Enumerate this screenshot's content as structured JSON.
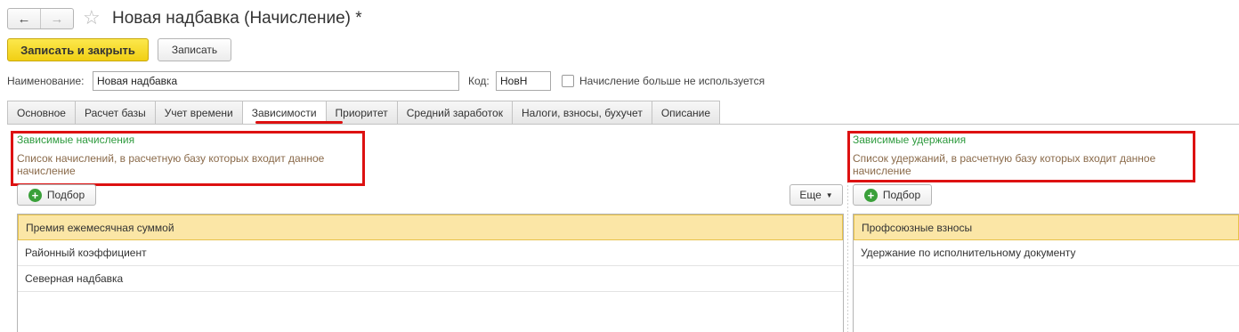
{
  "window": {
    "title": "Новая надбавка (Начисление) *",
    "nav_back": "←",
    "nav_forward": "→",
    "favorite_glyph": "☆"
  },
  "toolbar": {
    "save_close_label": "Записать и закрыть",
    "save_label": "Записать"
  },
  "fields": {
    "name_label": "Наименование:",
    "name_value": "Новая надбавка",
    "code_label": "Код:",
    "code_value": "НовН",
    "not_used_label": "Начисление больше не используется",
    "not_used_checked": false
  },
  "tabs": [
    {
      "label": "Основное",
      "active": false
    },
    {
      "label": "Расчет базы",
      "active": false
    },
    {
      "label": "Учет времени",
      "active": false
    },
    {
      "label": "Зависимости",
      "active": true
    },
    {
      "label": "Приоритет",
      "active": false
    },
    {
      "label": "Средний заработок",
      "active": false
    },
    {
      "label": "Налоги, взносы, бухучет",
      "active": false
    },
    {
      "label": "Описание",
      "active": false
    }
  ],
  "left_group": {
    "title": "Зависимые начисления",
    "description": "Список начислений, в расчетную базу которых входит данное начисление",
    "pick_label": "Подбор",
    "more_label": "Еще",
    "rows": [
      "Премия ежемесячная суммой",
      "Районный коэффициент",
      "Северная надбавка"
    ]
  },
  "right_group": {
    "title": "Зависимые удержания",
    "description": "Список удержаний, в расчетную базу которых входит данное начисление",
    "pick_label": "Подбор",
    "rows": [
      "Профсоюзные взносы",
      "Удержание по исполнительному документу"
    ]
  },
  "colors": {
    "accent_yellow": "#f5d623",
    "group_title_green": "#2f9b3f",
    "highlight_red": "#dd1111",
    "selected_row": "#fbe6a6"
  }
}
